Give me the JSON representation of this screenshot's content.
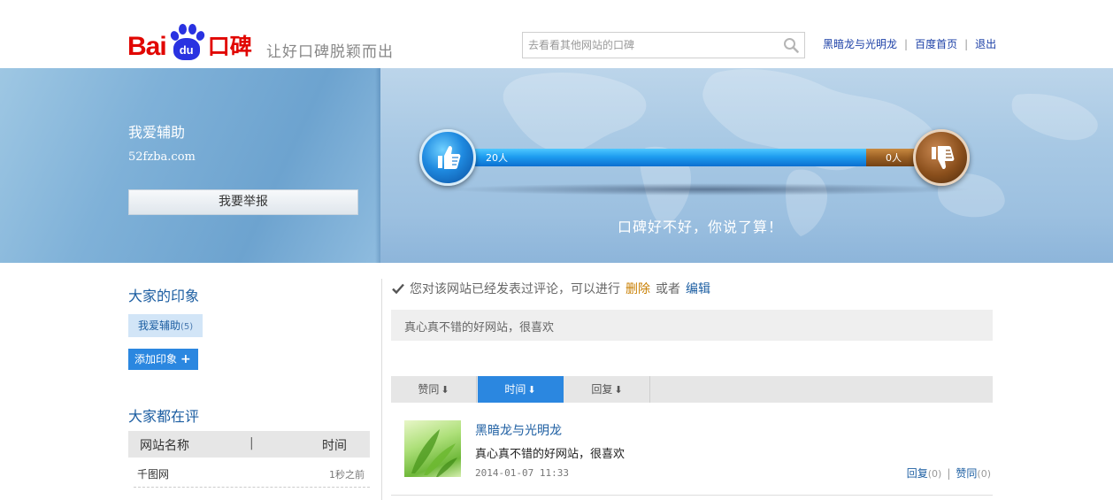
{
  "header": {
    "logo_text": "Bai",
    "logo_paw_text": "du",
    "logo_suffix": "口碑",
    "slogan": "让好口碑脱颖而出",
    "search": {
      "placeholder": "去看看其他网站的口碑"
    },
    "links": {
      "user": "黑暗龙与光明龙",
      "home": "百度首页",
      "logout": "退出"
    }
  },
  "banner": {
    "site_name": "我爱辅助",
    "site_url": "52fzba.com",
    "report_label": "我要举报",
    "like_count_label": "20人",
    "dislike_count_label": "0人",
    "likes": 20,
    "dislikes": 0,
    "like_fraction": 0.86,
    "slogan": "口碑好不好，你说了算！"
  },
  "impressions": {
    "title": "大家的印象",
    "tag_label": "我爱辅助",
    "tag_count": "(5)",
    "add_label": "添加印象"
  },
  "evaluating": {
    "title": "大家都在评",
    "col_name": "网站名称",
    "col_sep": "|",
    "col_time": "时间",
    "rows": [
      {
        "name": "千图网",
        "time": "1秒之前"
      }
    ]
  },
  "notice": {
    "text": "您对该网站已经发表过评论，可以进行",
    "delete_label": "删除",
    "or": "或者",
    "edit_label": "编辑"
  },
  "my_review": "真心真不错的好网站，很喜欢",
  "sort": {
    "tabs": [
      {
        "label": "赞同"
      },
      {
        "label": "时间"
      },
      {
        "label": "回复"
      }
    ]
  },
  "comment": {
    "user": "黑暗龙与光明龙",
    "text": "真心真不错的好网站，很喜欢",
    "time": "2014-01-07 11:33",
    "reply_label": "回复",
    "reply_count": "(0)",
    "agree_label": "赞同",
    "agree_count": "(0)"
  },
  "colors": {
    "brand_red": "#e10601",
    "brand_blue": "#2932e1",
    "link_blue": "#1c5ea2",
    "accent_blue": "#2b87e0",
    "delete_orange": "#c87e00"
  }
}
